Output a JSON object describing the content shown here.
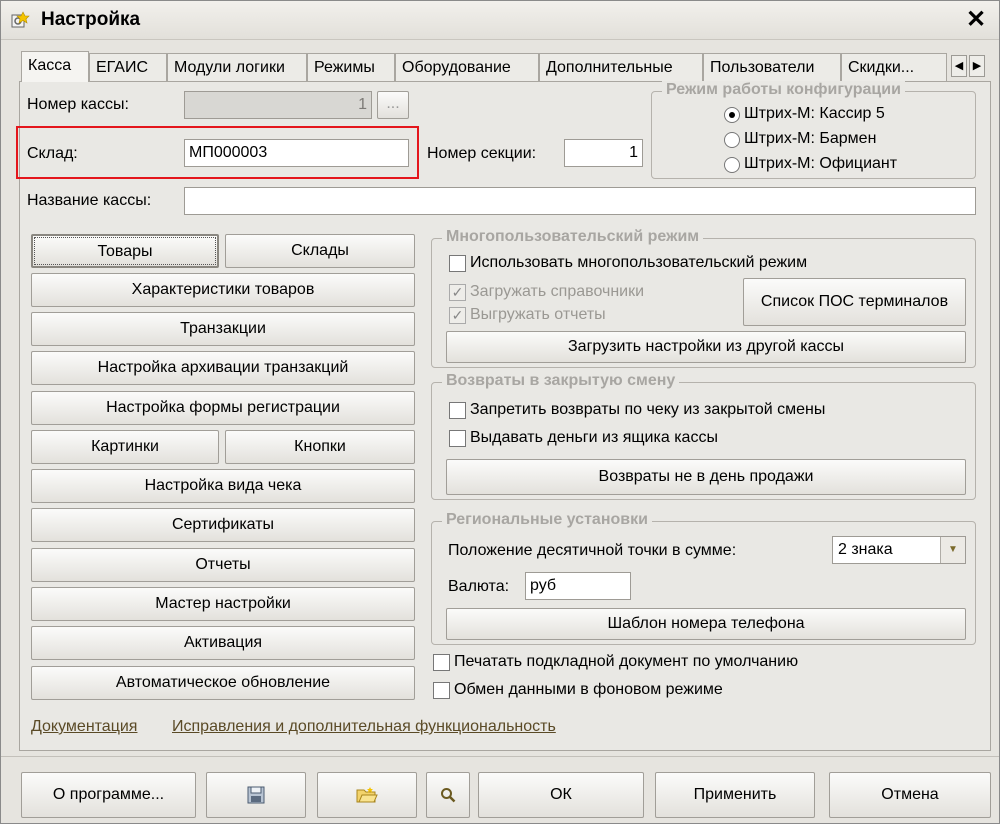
{
  "window": {
    "title": "Настройка",
    "close_glyph": "✕"
  },
  "tabs": [
    "Касса",
    "ЕГАИС",
    "Модули логики",
    "Режимы",
    "Оборудование",
    "Дополнительные",
    "Пользователи",
    "Скидки..."
  ],
  "tab_scroll": {
    "left": "◀",
    "right": "▶"
  },
  "fields": {
    "register_number": {
      "label": "Номер кассы:",
      "value": "1",
      "dots": "..."
    },
    "warehouse": {
      "label": "Склад:",
      "value": "МП000003"
    },
    "section_number": {
      "label": "Номер секции:",
      "value": "1"
    },
    "register_name": {
      "label": "Название кассы:",
      "value": ""
    }
  },
  "config_mode": {
    "title": "Режим работы конфигурации",
    "options": [
      "Штрих-М: Кассир 5",
      "Штрих-М: Бармен",
      "Штрих-М: Официант"
    ],
    "selected_index": 0
  },
  "left_buttons": {
    "goods": "Товары",
    "warehouses": "Склады",
    "product_characteristics": "Характеристики товаров",
    "transactions": "Транзакции",
    "transaction_archive": "Настройка архивации транзакций",
    "registration_form": "Настройка формы регистрации",
    "pictures": "Картинки",
    "buttons": "Кнопки",
    "receipt_view": "Настройка вида чека",
    "certificates": "Сертификаты",
    "reports": "Отчеты",
    "setup_wizard": "Мастер настройки",
    "activation": "Активация",
    "auto_update": "Автоматическое обновление"
  },
  "multiuser": {
    "title": "Многопользовательский режим",
    "use": "Использовать многопользовательский режим",
    "load_refs": "Загружать справочники",
    "upload_reports": "Выгружать отчеты",
    "pos_list": "Список ПОС терминалов",
    "load_settings": "Загрузить настройки из другой кассы",
    "check": "✓"
  },
  "returns": {
    "title": "Возвраты в закрытую смену",
    "forbid": "Запретить возвраты по чеку из закрытой смены",
    "give_money": "Выдавать деньги из ящика кассы",
    "not_sale_day": "Возвраты не в день продажи"
  },
  "regional": {
    "title": "Региональные установки",
    "decimal_label": "Положение десятичной точки в сумме:",
    "decimal_value": "2 знака",
    "currency_label": "Валюта:",
    "currency_value": "руб",
    "phone_template": "Шаблон номера телефона"
  },
  "misc": {
    "print_doc": "Печатать подкладной документ по умолчанию",
    "background_exchange": "Обмен данными в фоновом режиме"
  },
  "links": {
    "docs": "Документация",
    "fixes": "Исправления и дополнительная функциональность"
  },
  "footer": {
    "about": "О программе...",
    "ok": "ОК",
    "apply": "Применить",
    "cancel": "Отмена"
  },
  "colors": {
    "highlight": "#e4161c"
  }
}
